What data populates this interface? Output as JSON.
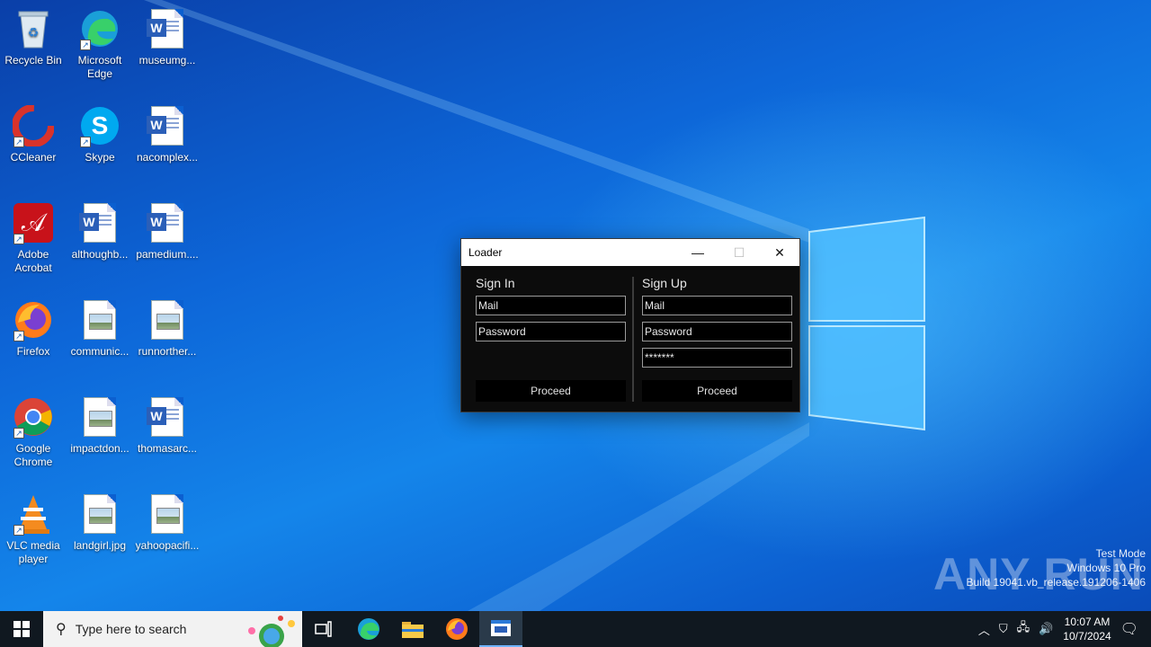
{
  "desktop": {
    "icons": [
      {
        "label": "Recycle Bin"
      },
      {
        "label": "Microsoft Edge"
      },
      {
        "label": "museumg..."
      },
      {
        "label": "CCleaner"
      },
      {
        "label": "Skype"
      },
      {
        "label": "nacomplex..."
      },
      {
        "label": "Adobe Acrobat"
      },
      {
        "label": "althoughb..."
      },
      {
        "label": "pamedium...."
      },
      {
        "label": "Firefox"
      },
      {
        "label": "communic..."
      },
      {
        "label": "runnorther..."
      },
      {
        "label": "Google Chrome"
      },
      {
        "label": "impactdon..."
      },
      {
        "label": "thomasarc..."
      },
      {
        "label": "VLC media player"
      },
      {
        "label": "landgirl.jpg"
      },
      {
        "label": "yahoopacifi..."
      }
    ]
  },
  "loader": {
    "title": "Loader",
    "minimize_glyph": "—",
    "maximize_glyph": "☐",
    "close_glyph": "✕",
    "sign_in": {
      "heading": "Sign In",
      "mail_value": "Mail",
      "password_value": "Password",
      "button": "Proceed"
    },
    "sign_up": {
      "heading": "Sign Up",
      "mail_value": "Mail",
      "password_value": "Password",
      "confirm_value": "*******",
      "button": "Proceed"
    }
  },
  "watermark": {
    "logo": "ANY RUN",
    "line1": "Test Mode",
    "line2": "Windows 10 Pro",
    "line3": "Build 19041.vb_release.191206-1406"
  },
  "taskbar": {
    "search_placeholder": "Type here to search",
    "time": "10:07 AM",
    "date": "10/7/2024"
  },
  "colors": {
    "taskbar_bg": "#101820",
    "window_bg": "#0c0c0c",
    "accent": "#0b5fd0"
  }
}
